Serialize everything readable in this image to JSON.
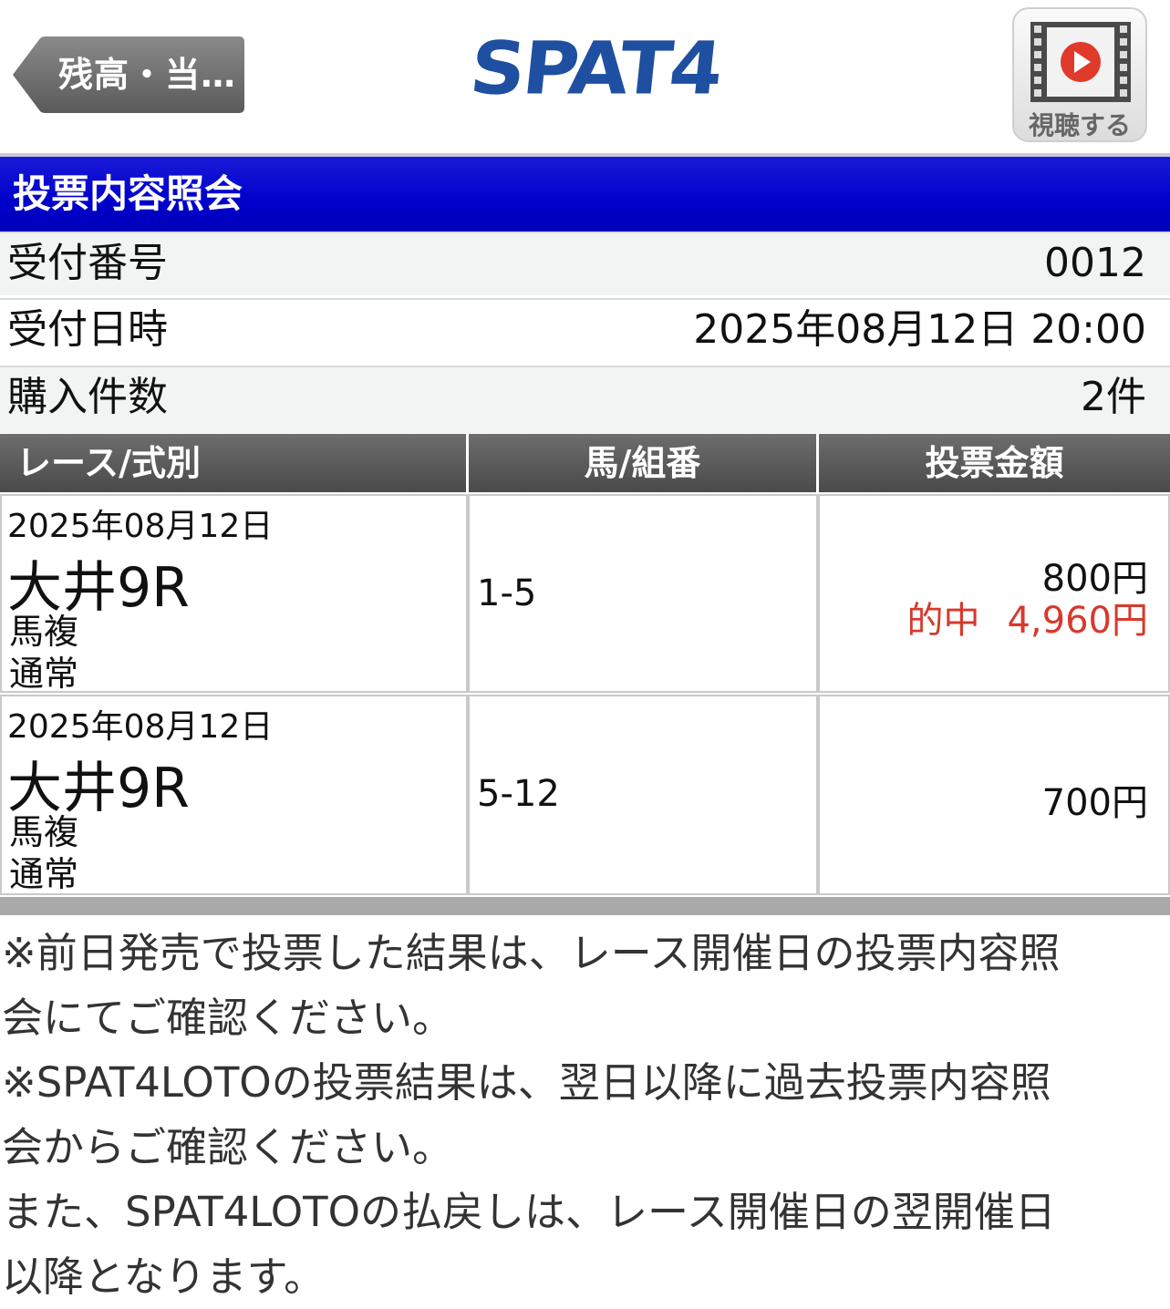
{
  "header": {
    "back_label": "残高・当…",
    "logo_text": "SPAT4",
    "watch_label": "視聴する"
  },
  "title": "投票内容照会",
  "info": [
    {
      "label": "受付番号",
      "value": "0012"
    },
    {
      "label": "受付日時",
      "value": "2025年08月12日 20:00"
    },
    {
      "label": "購入件数",
      "value": "2件"
    }
  ],
  "table": {
    "headers": [
      "レース/式別",
      "馬/組番",
      "投票金額"
    ],
    "rows": [
      {
        "date": "2025年08月12日",
        "race": "大井9R",
        "bet_type": "馬複",
        "bet_kind": "通常",
        "combo": "1-5",
        "amount": "800円",
        "hit_label": "的中",
        "payout": "4,960円"
      },
      {
        "date": "2025年08月12日",
        "race": "大井9R",
        "bet_type": "馬複",
        "bet_kind": "通常",
        "combo": "5-12",
        "amount": "700円"
      }
    ]
  },
  "notes": [
    "※前日発売で投票した結果は、レース開催日の投票内容照",
    "会にてご確認ください。",
    "※SPAT4LOTOの投票結果は、翌日以降に過去投票内容照",
    "会からご確認ください。",
    "また、SPAT4LOTOの払戻しは、レース開催日の翌開催日",
    "以降となります。"
  ],
  "colors": {
    "title_bar": "#0000cc",
    "logo": "#1f4fa0",
    "hit": "#d8382c",
    "table_header": "#555555"
  }
}
